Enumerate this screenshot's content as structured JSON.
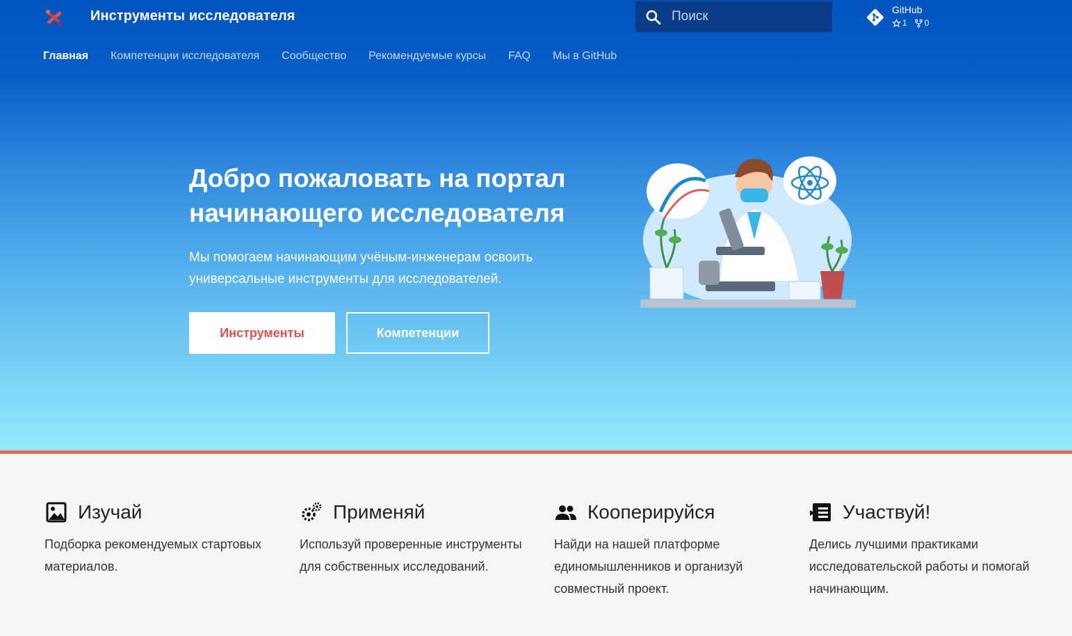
{
  "header": {
    "site_title": "Инструменты исследователя",
    "search": {
      "placeholder": "Поиск"
    },
    "repo": {
      "name": "GitHub",
      "stars": "1",
      "forks": "0"
    }
  },
  "tabs": [
    {
      "label": "Главная",
      "active": true
    },
    {
      "label": "Компетенции исследователя"
    },
    {
      "label": "Сообщество"
    },
    {
      "label": "Рекомендуемые курсы"
    },
    {
      "label": "FAQ"
    },
    {
      "label": "Мы в GitHub"
    }
  ],
  "hero": {
    "title_line1": "Добро пожаловать на портал",
    "title_line2": "начинающего исследователя",
    "text_line1": "Мы помогаем начинающим учёным-инженерам освоить",
    "text_line2": "универсальные инструменты для исследователей.",
    "primary_button": "Инструменты",
    "secondary_button": "Компетенции"
  },
  "features": [
    {
      "icon": "image-icon",
      "title": "Изучай",
      "lines": [
        "Подборка рекомендуемых стартовых",
        "материалов."
      ]
    },
    {
      "icon": "gears-icon",
      "title": "Применяй",
      "lines": [
        "Используй проверенные инструменты",
        "для собственных исследований."
      ]
    },
    {
      "icon": "people-icon",
      "title": "Кооперируйся",
      "lines": [
        "Найди на нашей платформе",
        "единомышленников и организуй",
        "совместный проект."
      ]
    },
    {
      "icon": "contribute-icon",
      "title": "Участвуй!",
      "lines": [
        "Делись лучшими практиками",
        "исследовательской работы и помогай",
        "начинающим."
      ]
    }
  ],
  "colors": {
    "header_blue": "#0154c0",
    "accent_red": "#e3524a",
    "divider": "#e86a5c",
    "search_bg": "#0a3c87"
  }
}
